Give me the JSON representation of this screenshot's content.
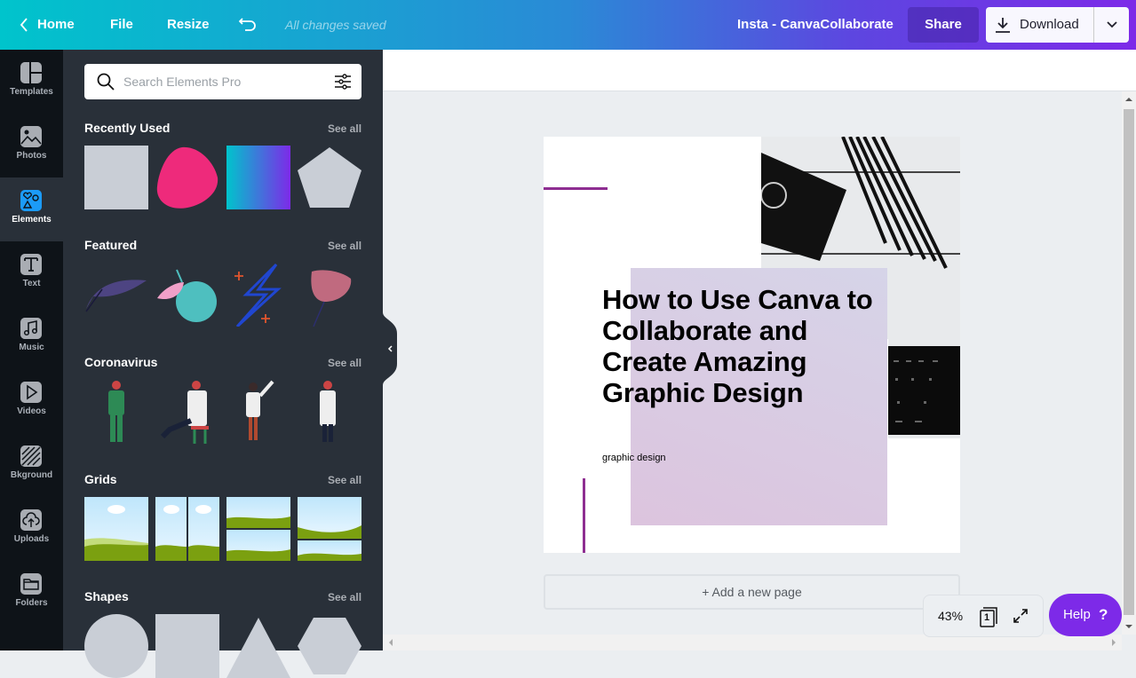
{
  "topbar": {
    "home_label": "Home",
    "file_label": "File",
    "resize_label": "Resize",
    "save_status": "All changes saved",
    "doc_title": "Insta - CanvaCollaborate",
    "share_label": "Share",
    "download_label": "Download",
    "gradient_colors": [
      "#00c4cc",
      "#7d2ae8"
    ]
  },
  "rail": {
    "items": [
      {
        "label": "Templates",
        "icon": "templates-icon"
      },
      {
        "label": "Photos",
        "icon": "photos-icon"
      },
      {
        "label": "Elements",
        "icon": "elements-icon",
        "active": true
      },
      {
        "label": "Text",
        "icon": "text-icon"
      },
      {
        "label": "Music",
        "icon": "music-icon"
      },
      {
        "label": "Videos",
        "icon": "videos-icon"
      },
      {
        "label": "Bkground",
        "icon": "background-icon"
      },
      {
        "label": "Uploads",
        "icon": "uploads-icon"
      },
      {
        "label": "Folders",
        "icon": "folders-icon"
      }
    ]
  },
  "panel": {
    "search_placeholder": "Search Elements Pro",
    "sections": [
      {
        "title": "Recently Used",
        "see_all": "See all",
        "items": [
          "gray-square",
          "pink-blob",
          "teal-purple-gradient",
          "gray-pentagon"
        ]
      },
      {
        "title": "Featured",
        "see_all": "See all",
        "items": [
          "purple-leaf",
          "lime-with-leaf",
          "lightning-bolt",
          "pink-flower"
        ]
      },
      {
        "title": "Coronavirus",
        "see_all": "See all",
        "items": [
          "doctor-scrubs",
          "doctor-sitting",
          "doctor-pointing",
          "doctor-arms-crossed"
        ]
      },
      {
        "title": "Grids",
        "see_all": "See all",
        "items": [
          "grid-single",
          "grid-two-columns",
          "grid-two-rows",
          "grid-two-rows-uneven"
        ]
      },
      {
        "title": "Shapes",
        "see_all": "See all",
        "items": [
          "circle",
          "square",
          "triangle",
          "hexagon"
        ]
      }
    ]
  },
  "canvas": {
    "headline": "How to Use Canva to Collaborate and Create Amazing Graphic Design",
    "subtitle": "graphic design",
    "accent_color": "#8e2e91",
    "add_page_label": "+ Add a new page"
  },
  "footer": {
    "zoom_level": "43%",
    "page_count": "1",
    "help_label": "Help",
    "help_glyph": "?"
  }
}
